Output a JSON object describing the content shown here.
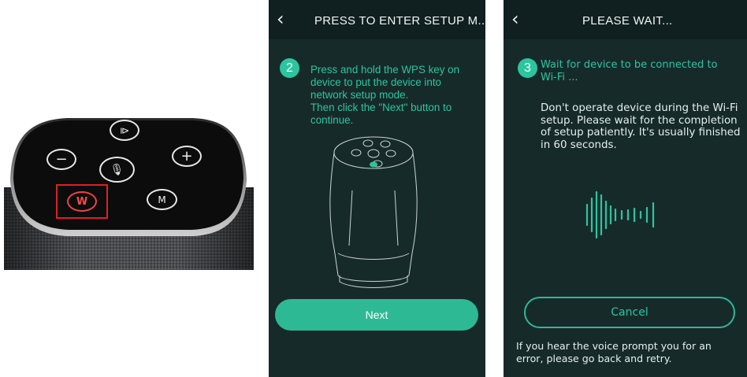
{
  "speaker": {
    "buttons": [
      {
        "name": "play-pause-key",
        "glyph": "⧐"
      },
      {
        "name": "volume-down-key",
        "glyph": "−"
      },
      {
        "name": "microphone-key",
        "glyph": "🎙"
      },
      {
        "name": "volume-up-key",
        "glyph": "+"
      },
      {
        "name": "mode-key",
        "glyph": "M"
      }
    ],
    "wps_label": "W",
    "highlight_color": "#e02020"
  },
  "screen1": {
    "back_glyph": "‹",
    "title": "PRESS TO ENTER SETUP M...",
    "step_number": "2",
    "step_lines": [
      "Press and hold the WPS key on",
      "device to put the device into",
      "network setup mode.",
      "Then click the \"Next\" button to",
      "continue."
    ],
    "next_label": "Next"
  },
  "screen2": {
    "back_glyph": "‹",
    "title": "PLEASE WAIT...",
    "step_number": "3",
    "step_lines": [
      "Wait for device to be connected to",
      "Wi-Fi ..."
    ],
    "info_lines": [
      "Don't operate device during the Wi-Fi",
      "setup. Please wait for the completion",
      "of setup patiently. It's usually finished",
      "in 60 seconds."
    ],
    "cancel_label": "Cancel",
    "bottom_lines": [
      "If you hear the voice prompt you for an",
      "error, please go back and retry."
    ]
  },
  "colors": {
    "accent": "#2cc59f",
    "button": "#2eb995",
    "screen_bg": "#172a2a",
    "header_bg": "#101f1f"
  }
}
